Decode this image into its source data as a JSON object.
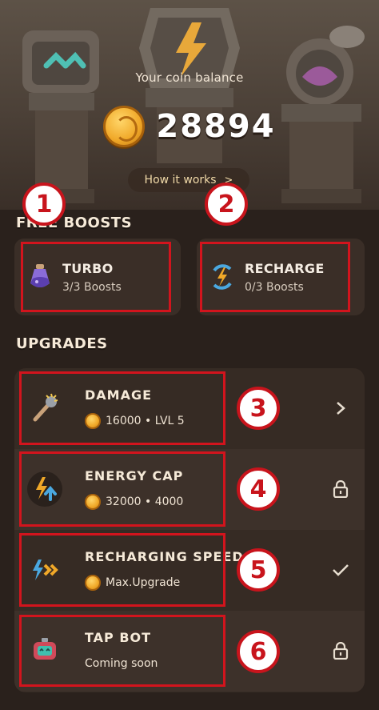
{
  "header": {
    "balance_label": "Your coin balance",
    "balance_value": "28894",
    "how_it_works": "How it works",
    "how_it_works_chevron": ">"
  },
  "boosts": {
    "title": "FREE BOOSTS",
    "items": [
      {
        "name": "TURBO",
        "sub": "3/3 Boosts",
        "icon": "potion-icon"
      },
      {
        "name": "RECHARGE",
        "sub": "0/3 Boosts",
        "icon": "recharge-icon"
      }
    ]
  },
  "upgrades": {
    "title": "UPGRADES",
    "items": [
      {
        "name": "DAMAGE",
        "sub": "16000 • LVL 5",
        "icon": "mace-icon",
        "action": "chevron-right-icon",
        "has_coin": true
      },
      {
        "name": "ENERGY CAP",
        "sub": "32000 • 4000",
        "icon": "energy-up-icon",
        "action": "lock-icon",
        "has_coin": true
      },
      {
        "name": "RECHARGING SPEED",
        "sub": "Max.Upgrade",
        "icon": "lightning-speed-icon",
        "action": "check-icon",
        "has_coin": true
      },
      {
        "name": "TAP BOT",
        "sub": "Coming soon",
        "icon": "robot-icon",
        "action": "lock-icon",
        "has_coin": false
      }
    ]
  },
  "annotations": [
    "1",
    "2",
    "3",
    "4",
    "5",
    "6"
  ],
  "colors": {
    "background": "#2a211c",
    "card": "#3a2e27",
    "accent_red": "#d2141d",
    "coin_gold": "#f0a828",
    "text": "#f4ece2"
  }
}
